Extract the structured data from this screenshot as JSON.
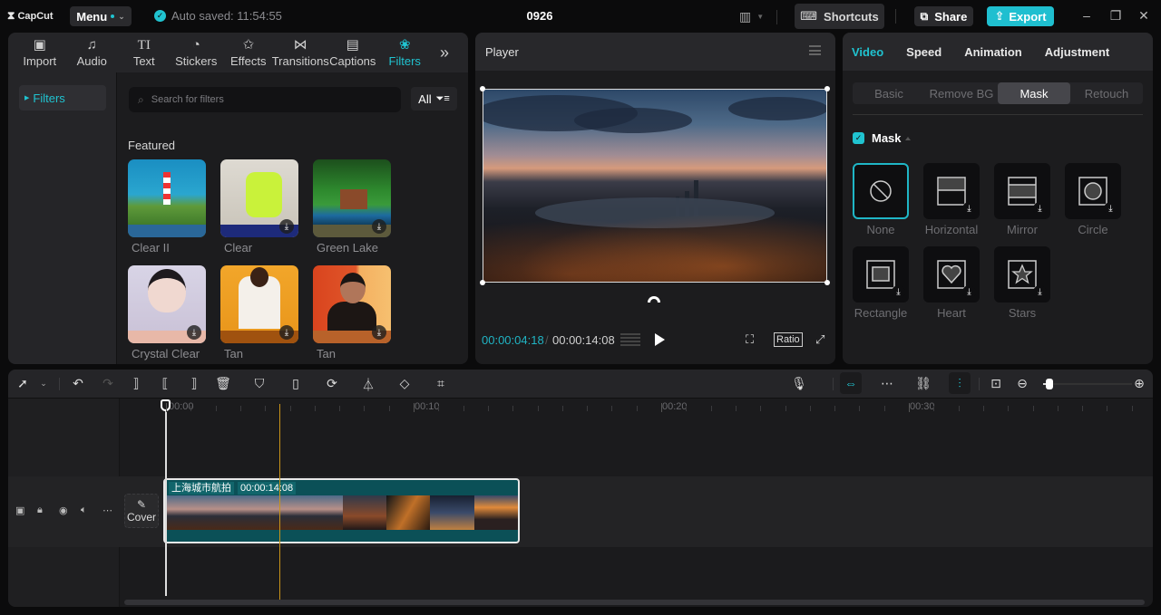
{
  "titlebar": {
    "app_name": "CapCut",
    "menu_label": "Menu",
    "autosave_text": "Auto saved: 11:54:55",
    "project_title": "0926",
    "shortcuts_label": "Shortcuts",
    "share_label": "Share",
    "export_label": "Export",
    "accent_color": "#1fbfd0"
  },
  "media_panel": {
    "tabs": [
      {
        "label": "Import",
        "icon": "import-icon"
      },
      {
        "label": "Audio",
        "icon": "audio-icon"
      },
      {
        "label": "Text",
        "icon": "text-icon"
      },
      {
        "label": "Stickers",
        "icon": "stickers-icon"
      },
      {
        "label": "Effects",
        "icon": "effects-icon"
      },
      {
        "label": "Transitions",
        "icon": "transitions-icon"
      },
      {
        "label": "Captions",
        "icon": "captions-icon"
      },
      {
        "label": "Filters",
        "icon": "filters-icon",
        "active": true
      }
    ],
    "nav_item": "Filters",
    "search_placeholder": "Search for filters",
    "all_label": "All",
    "section_title": "Featured",
    "filters": [
      {
        "name": "Clear II",
        "download": false
      },
      {
        "name": "Clear",
        "download": true
      },
      {
        "name": "Green Lake",
        "download": true
      },
      {
        "name": "Crystal Clear",
        "download": true
      },
      {
        "name": "Tan",
        "download": true
      },
      {
        "name": "Tan",
        "download": true
      }
    ]
  },
  "player": {
    "title": "Player",
    "current_time": "00:00:04:18",
    "separator": "/",
    "total_time": "00:00:14:08",
    "ratio_label": "Ratio"
  },
  "properties": {
    "tabs": [
      "Video",
      "Speed",
      "Animation",
      "Adjustment"
    ],
    "active_tab": "Video",
    "subtabs": [
      "Basic",
      "Remove BG",
      "Mask",
      "Retouch"
    ],
    "active_subtab": "Mask",
    "mask_label": "Mask",
    "mask_enabled": true,
    "mask_options": [
      {
        "name": "None",
        "selected": true
      },
      {
        "name": "Horizontal"
      },
      {
        "name": "Mirror"
      },
      {
        "name": "Circle"
      },
      {
        "name": "Rectangle"
      },
      {
        "name": "Heart"
      },
      {
        "name": "Stars"
      }
    ]
  },
  "timeline": {
    "ruler": [
      "00:00",
      "00:10",
      "00:20",
      "00:30"
    ],
    "cover_label": "Cover",
    "clip_name": "上海城市航拍",
    "clip_duration": "00:00:14:08",
    "zoom_level_fraction": 0.05
  }
}
